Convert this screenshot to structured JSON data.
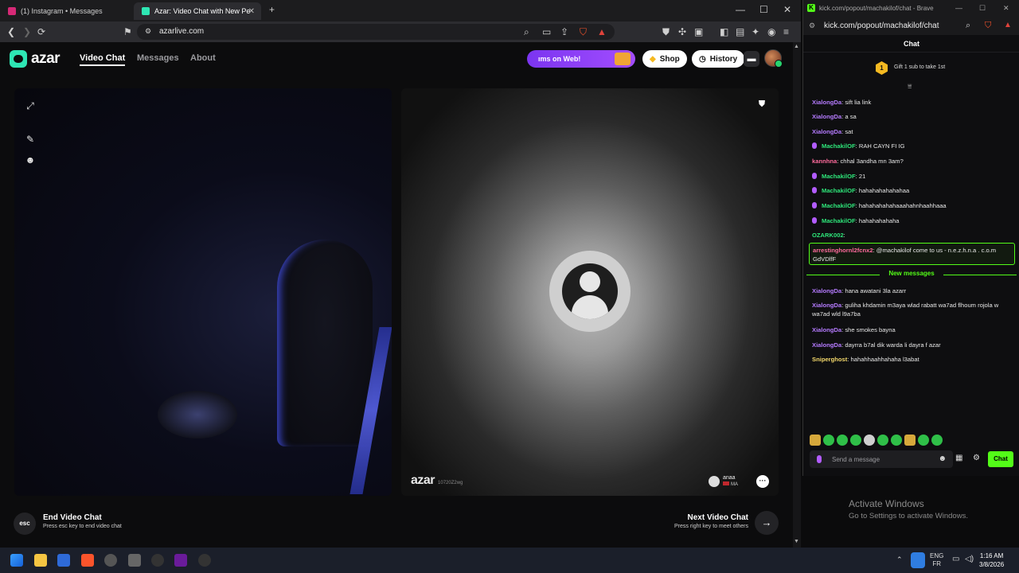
{
  "browser": {
    "tabs": [
      {
        "label": "(1) Instagram • Messages",
        "favicon_color": "#d62976"
      },
      {
        "label": "Azar: Video Chat with New Pe",
        "favicon_color": "#2ee6b4"
      }
    ],
    "url": "azarlive.com"
  },
  "site": {
    "logo": "azar",
    "nav": [
      "Video Chat",
      "Messages",
      "About"
    ],
    "promo": "ıms on Web!",
    "shop": "Shop",
    "history": "History"
  },
  "video": {
    "watermark": "azar",
    "watermark_id": "10720Z2wg",
    "partner_name": "anaa",
    "partner_country": "MA"
  },
  "controls": {
    "esc_key": "esc",
    "end_title": "End Video Chat",
    "end_sub": "Press esc key to end video chat",
    "next_title": "Next Video Chat",
    "next_sub": "Press right key to meet others"
  },
  "chat_window": {
    "window_title": "kick.com/popout/machakilof/chat - Brave",
    "url": "kick.com/popout/machakilof/chat",
    "header": "Chat",
    "gift_num": "1",
    "gift_text": "Gift 1 sub to take 1st",
    "messages": [
      {
        "user": "XialongDa",
        "text": ": sift lia link",
        "color": "purple",
        "mic": false
      },
      {
        "user": "XialongDa",
        "text": ": a sa",
        "color": "purple",
        "mic": false
      },
      {
        "user": "XialongDa",
        "text": ": sat",
        "color": "purple",
        "mic": false
      },
      {
        "user": "MachakilOF",
        "text": ": RAH CAYN FI IG",
        "color": "green",
        "mic": true
      },
      {
        "user": "kannhna",
        "text": ": chhal 3andha mn 3am?",
        "color": "pink",
        "mic": false
      },
      {
        "user": "MachakilOF",
        "text": ": 21",
        "color": "green",
        "mic": true
      },
      {
        "user": "MachakilOF",
        "text": ": hahahahahahahaa",
        "color": "green",
        "mic": true
      },
      {
        "user": "MachakilOF",
        "text": ": hahahahahahaaahahnhaahhaaa",
        "color": "green",
        "mic": true
      },
      {
        "user": "MachakilOF",
        "text": ": hahahahahaha",
        "color": "green",
        "mic": true
      },
      {
        "user": "OZARK002",
        "text": ":",
        "color": "green",
        "mic": false
      }
    ],
    "highlight": {
      "user": "arrestinghornl2fcnx2",
      "text": ": @machakilof come to us - n.e.z.h.n.a . c.o.m GdVDlfF"
    },
    "new_messages_label": "New messages",
    "new_messages": [
      {
        "user": "XialongDa",
        "text": ": hana awatani 3la azarr",
        "color": "purple"
      },
      {
        "user": "XialongDa",
        "text": ": guliha khdamin m3aya wlad rabatt wa7ad flhoum rojola w wa7ad wld l9a7ba",
        "color": "purple"
      },
      {
        "user": "XialongDa",
        "text": ": she smokes bayna",
        "color": "purple"
      },
      {
        "user": "XialongDa",
        "text": ": dayrra b7al dik warda li dayra f azar",
        "color": "purple"
      },
      {
        "user": "Sniperghost",
        "text": ": hahahhaahhahaha l3abat",
        "color": "yellow"
      }
    ],
    "input_placeholder": "Send a message",
    "chat_button": "Chat"
  },
  "windows": {
    "activate_title": "Activate Windows",
    "activate_sub": "Go to Settings to activate Windows.",
    "lang_top": "ENG",
    "lang_bottom": "FR",
    "time": "1:16 AM",
    "date": "3/8/2026"
  }
}
